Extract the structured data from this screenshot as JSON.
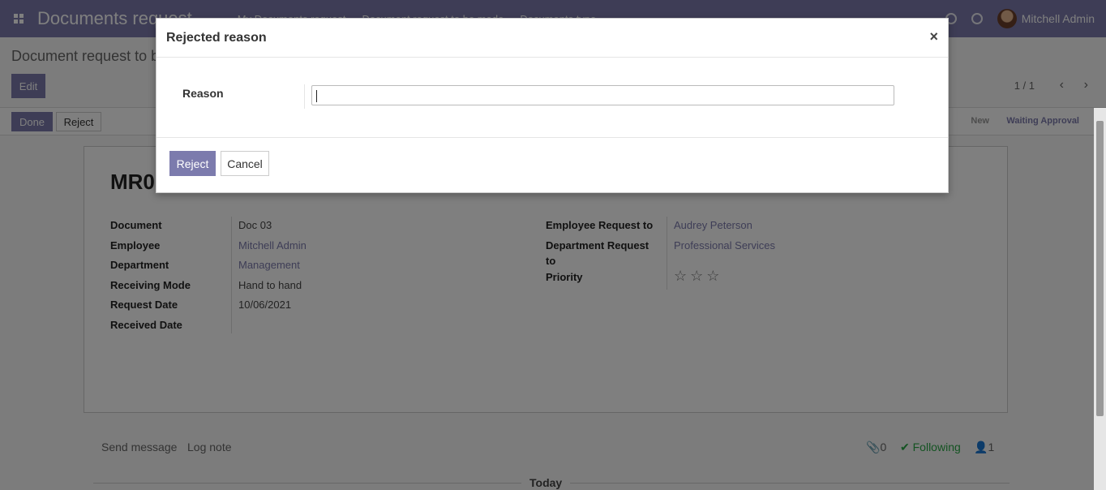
{
  "navbar": {
    "app_title": "Documents request",
    "menu": [
      "My Documents request",
      "Document request to be made",
      "Documents type"
    ],
    "user_name": "Mitchell Admin"
  },
  "control_panel": {
    "breadcrumb": "Document request to be made",
    "edit_label": "Edit",
    "pager": "1 / 1"
  },
  "statusbar": {
    "done_label": "Done",
    "reject_label": "Reject",
    "stages": [
      "New",
      "Waiting Approval"
    ]
  },
  "form": {
    "record_name": "MR0",
    "left_fields": [
      {
        "label": "Document",
        "value": "Doc 03"
      },
      {
        "label": "Employee",
        "value": "Mitchell Admin"
      },
      {
        "label": "Department",
        "value": "Management"
      },
      {
        "label": "Receiving Mode",
        "value": "Hand to hand"
      },
      {
        "label": "Request Date",
        "value": "10/06/2021"
      },
      {
        "label": "Received Date",
        "value": ""
      }
    ],
    "right_fields": [
      {
        "label": "Employee Request to",
        "value": "Audrey Peterson"
      },
      {
        "label_line1": "Department Request",
        "label_line2": "to",
        "value": "Professional Services"
      },
      {
        "label": "Priority",
        "value": "☆ ☆ ☆"
      }
    ]
  },
  "chatter": {
    "send_message": "Send message",
    "log_note": "Log note",
    "attachments": "0",
    "following": "Following",
    "followers": "1",
    "today": "Today"
  },
  "modal": {
    "title": "Rejected reason",
    "close": "×",
    "reason_label": "Reason",
    "reason_value": "",
    "reject_label": "Reject",
    "cancel_label": "Cancel"
  },
  "colors": {
    "brand": "#7c7bad",
    "following": "#28a745"
  }
}
